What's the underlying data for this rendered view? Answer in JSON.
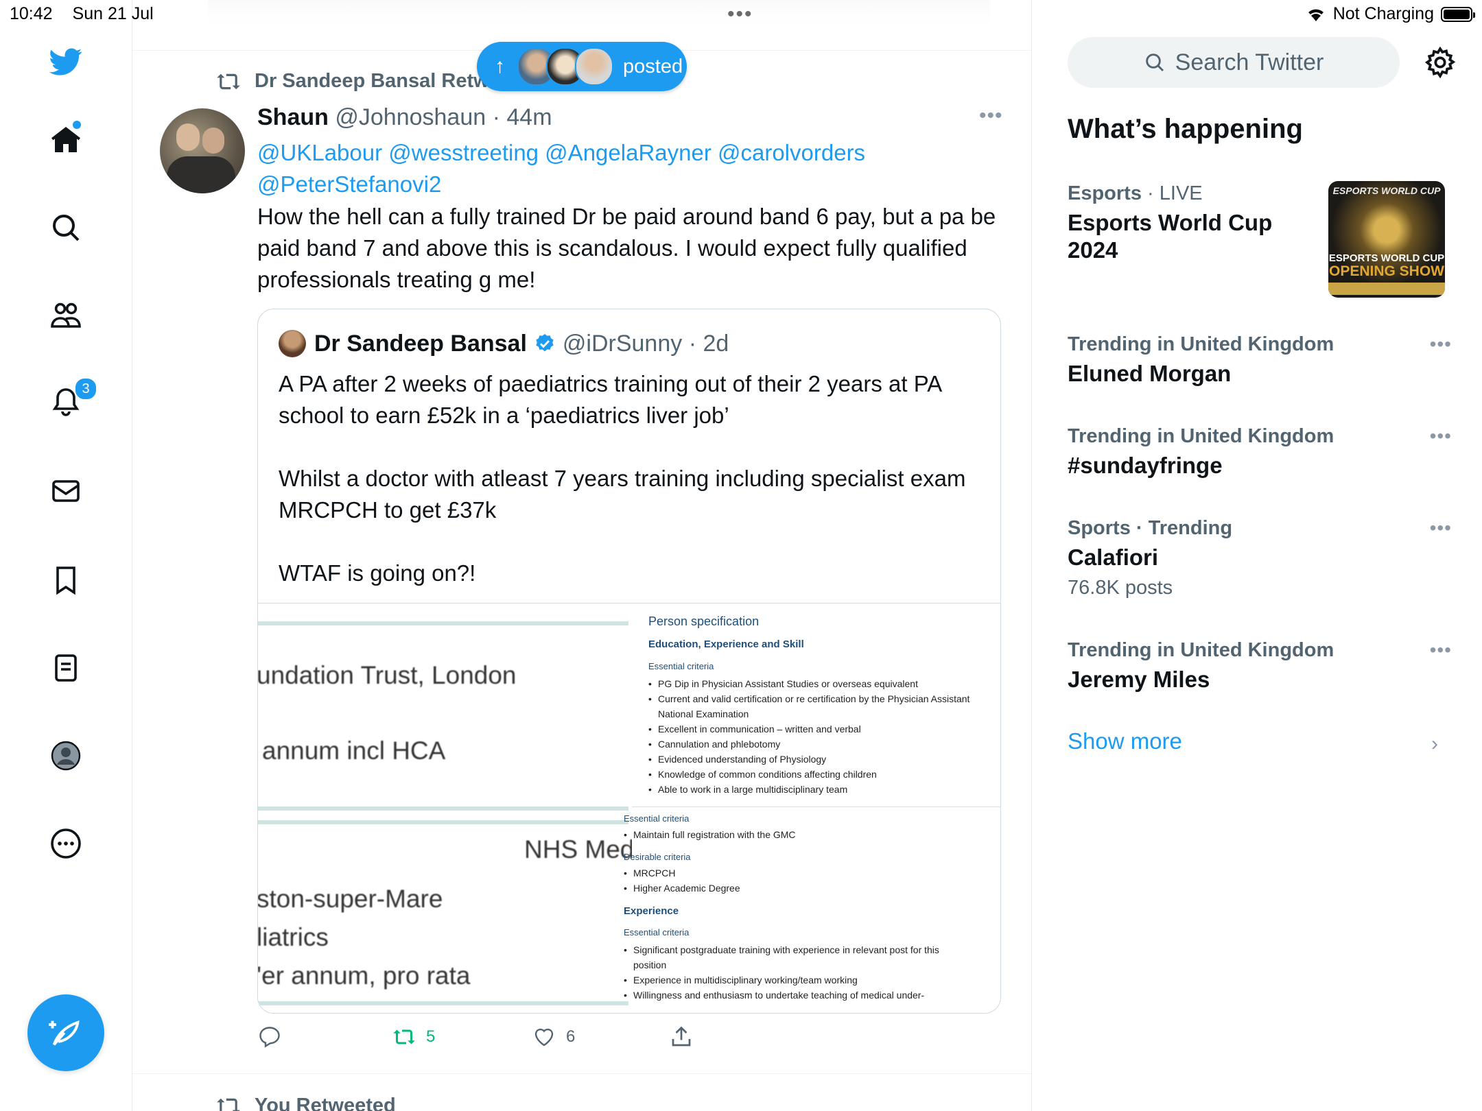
{
  "status_bar": {
    "time": "10:42",
    "date": "Sun 21 Jul",
    "battery_label": "Not Charging"
  },
  "nav": {
    "notifications_count": "3"
  },
  "new_posts_pill": {
    "label": "posted"
  },
  "tweet": {
    "retweeted_by": "Dr Sandeep Bansal Retw",
    "author_name": "Shaun",
    "author_handle": "@Johnoshaun",
    "time": "44m",
    "mentions_line1": "@UKLabour @wesstreeting @AngelaRayner @carolvorders",
    "mentions_line2": "@PeterStefanovi2",
    "text": "How the hell can a fully trained Dr be paid around band 6 pay, but a pa be paid band 7 and above this is scandalous. I would expect fully qualified professionals treating g me!",
    "reply_count": "",
    "retweet_count": "5",
    "like_count": "6"
  },
  "quote": {
    "author_name": "Dr Sandeep Bansal",
    "author_handle": "@iDrSunny",
    "time": "2d",
    "para1": "A PA after 2 weeks of paediatrics training out of their 2 years at PA school to earn £52k in a ‘paediatrics liver job’",
    "para2": "Whilst a doctor with atleast 7 years training including specialist exam MRCPCH to get £37k",
    "para3": "WTAF is going on?!",
    "image_left": {
      "line1": "undation Trust, London",
      "line2": "annum incl HCA",
      "line3": "NHS Med",
      "line4": "ston-super-Mare",
      "line5": "liatrics",
      "line6": "'er annum, pro rata"
    },
    "image_right": {
      "heading": "Person specification",
      "subheading": "Education, Experience and Skill",
      "essential1": "Essential criteria",
      "items1": [
        "PG Dip in Physician Assistant Studies or overseas equivalent",
        "Current and valid certification or re certification by the Physician Assistant National Examination",
        "Excellent in communication – written and verbal",
        "Cannulation and phlebotomy",
        "Evidenced understanding of Physiology",
        "Knowledge of common conditions affecting children",
        "Able to work in a large multidisciplinary team"
      ],
      "essential2": "Essential criteria",
      "item_gmc": "Maintain full registration with the GMC",
      "desirable": "Desirable criteria",
      "item_mrcpch": "MRCPCH",
      "item_higher": "Higher Academic Degree",
      "experience": "Experience",
      "essential3": "Essential criteria",
      "items3": [
        "Significant postgraduate training with experience in relevant post for this position",
        "Experience in multidisciplinary working/team working",
        "Willingness and enthusiasm to undertake teaching of medical under-"
      ]
    }
  },
  "next_item": {
    "label": "You Retweeted"
  },
  "right": {
    "search_placeholder": "Search Twitter",
    "section_title": "What’s happening",
    "trends": [
      {
        "category": "Esports",
        "qualifier": " · LIVE",
        "title": "Esports World Cup 2024",
        "count": ""
      },
      {
        "category": "Trending in United Kingdom",
        "qualifier": "",
        "title": "Eluned Morgan",
        "count": ""
      },
      {
        "category": "Trending in United Kingdom",
        "qualifier": "",
        "title": "#sundayfringe",
        "count": ""
      },
      {
        "category": "Sports · Trending",
        "qualifier": "",
        "title": "Calafiori",
        "count": "76.8K posts"
      },
      {
        "category": "Trending in United Kingdom",
        "qualifier": "",
        "title": "Jeremy Miles",
        "count": ""
      }
    ],
    "esports_image": {
      "top": "ESPORTS WORLD CUP",
      "line1": "ESPORTS WORLD CUP",
      "line2": "OPENING SHOW"
    },
    "show_more": "Show more"
  },
  "colors": {
    "accent": "#1d9bf0",
    "retweet_green": "#00ba7c",
    "secondary_text": "#536471"
  }
}
